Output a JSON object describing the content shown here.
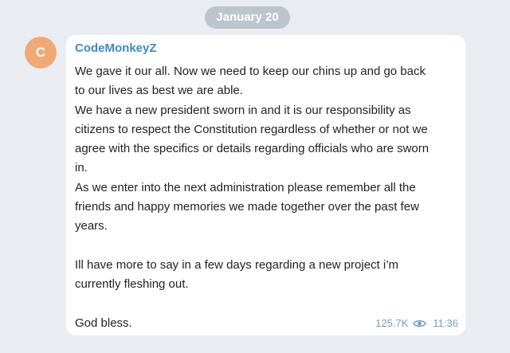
{
  "chat": {
    "date_label": "January 20",
    "message": {
      "avatar_letter": "C",
      "sender": "CodeMonkeyZ",
      "lines": [
        "We gave it our all. Now we need to keep our chins up and go back",
        "to our lives as best we are able.",
        "We have a new president sworn in and it is our responsibility as",
        "citizens to respect the Constitution regardless of whether or not we",
        "agree with the specifics or details regarding officials who are sworn",
        "in.",
        "As we enter into the next administration please remember all the",
        "friends and happy memories we made together over the past few",
        "years.",
        "",
        "Ill have more to say in a few days regarding a new project i’m",
        "currently fleshing out.",
        "",
        "God bless."
      ],
      "views": "125.7K",
      "time": "11:36"
    }
  },
  "colors": {
    "background": "#e9edf1",
    "date_pill": "#bcc5cc",
    "avatar": "#f0a974",
    "sender_name": "#3a8cc9",
    "meta": "#6f9ec9"
  },
  "icons": {
    "views": "eye-icon"
  }
}
